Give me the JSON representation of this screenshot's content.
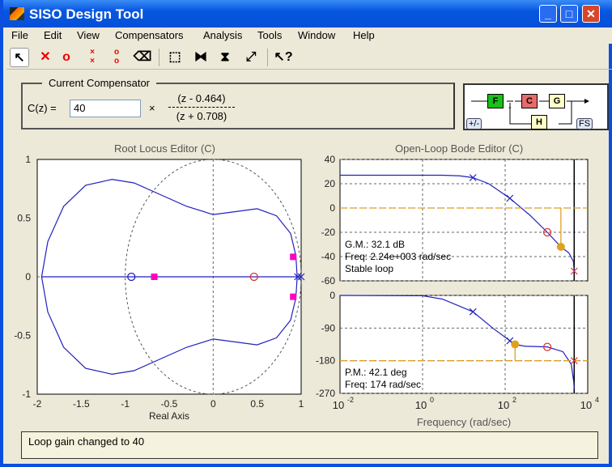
{
  "window": {
    "title": "SISO Design Tool"
  },
  "menu": [
    "File",
    "Edit",
    "View",
    "Compensators",
    "Analysis",
    "Tools",
    "Window",
    "Help"
  ],
  "compensator": {
    "legend": "Current Compensator",
    "label": "C(z) =",
    "gain": "40",
    "times": "×",
    "numerator": "(z - 0.464)",
    "denominator": "(z + 0.708)"
  },
  "diagram": {
    "blocks": [
      "F",
      "C",
      "G",
      "H"
    ],
    "sign_button": "+/-",
    "fs_button": "FS",
    "minus": "-"
  },
  "status": "Loop gain changed to 40",
  "colors": {
    "locus": "#2020c0",
    "accent": "#e0a020",
    "zero": "#e03030",
    "pink": "#ff00c0"
  },
  "chart_data": [
    {
      "type": "line",
      "title": "Root Locus Editor (C)",
      "xlabel": "Real Axis",
      "ylabel": "",
      "xlim": [
        -2,
        1
      ],
      "ylim": [
        -1,
        1
      ],
      "xticks": [
        "-2",
        "-1.5",
        "-1",
        "-0.5",
        "0",
        "0.5",
        "1"
      ],
      "yticks": [
        "1",
        "0.5",
        "0",
        "-0.5",
        "-1"
      ],
      "locus_upper": [
        [
          -1.95,
          0
        ],
        [
          -1.88,
          0.3
        ],
        [
          -1.7,
          0.6
        ],
        [
          -1.45,
          0.78
        ],
        [
          -1.15,
          0.83
        ],
        [
          -0.9,
          0.8
        ],
        [
          -0.6,
          0.7
        ],
        [
          -0.3,
          0.6
        ],
        [
          0,
          0.53
        ],
        [
          0.2,
          0.55
        ],
        [
          0.5,
          0.58
        ],
        [
          0.72,
          0.52
        ],
        [
          0.88,
          0.37
        ],
        [
          0.94,
          0.18
        ],
        [
          0.955,
          0
        ]
      ],
      "poles": [
        [
          0.96,
          0
        ],
        [
          1.0,
          0
        ]
      ],
      "zeros_comp": [
        [
          0.464,
          0
        ]
      ],
      "zeros_plant": [
        [
          -0.93,
          0
        ]
      ],
      "closed_loop_poles": [
        [
          -0.67,
          0
        ],
        [
          0.91,
          0.17
        ],
        [
          0.91,
          -0.17
        ]
      ]
    },
    {
      "type": "line",
      "title": "Open-Loop Bode Editor (C)",
      "xlabel": "Frequency (rad/sec)",
      "xlim": [
        0.01,
        10000
      ],
      "xticks": [
        "10-2",
        "100",
        "102",
        "104"
      ],
      "magnitude": {
        "ylim": [
          -60,
          40
        ],
        "yticks": [
          "40",
          "20",
          "0",
          "-20",
          "-40",
          "-60"
        ],
        "points": [
          [
            0.01,
            27
          ],
          [
            3,
            27
          ],
          [
            8,
            26.5
          ],
          [
            16.6,
            25
          ],
          [
            40,
            20
          ],
          [
            130,
            8
          ],
          [
            400,
            -6
          ],
          [
            1050,
            -20
          ],
          [
            2240,
            -32
          ],
          [
            3500,
            -37
          ],
          [
            4500,
            -44
          ],
          [
            4700,
            -53
          ]
        ],
        "annotations": [
          "G.M.: 32.1 dB",
          "Freq: 2.24e+003 rad/sec",
          "Stable loop"
        ]
      },
      "phase": {
        "ylim": [
          -270,
          0
        ],
        "yticks": [
          "0",
          "-90",
          "-180",
          "-270"
        ],
        "points": [
          [
            0.01,
            0
          ],
          [
            1,
            -1
          ],
          [
            3,
            -10
          ],
          [
            16.6,
            -45
          ],
          [
            50,
            -90
          ],
          [
            130,
            -125
          ],
          [
            174,
            -135
          ],
          [
            300,
            -140
          ],
          [
            1050,
            -142
          ],
          [
            2500,
            -155
          ],
          [
            4000,
            -190
          ],
          [
            4600,
            -240
          ],
          [
            4700,
            -258
          ]
        ],
        "annotations": [
          "P.M.: 42.1 deg",
          "Freq: 174 rad/sec"
        ]
      },
      "gm_freq": 2240,
      "pm_freq": 174,
      "nyquist": 4700
    }
  ]
}
